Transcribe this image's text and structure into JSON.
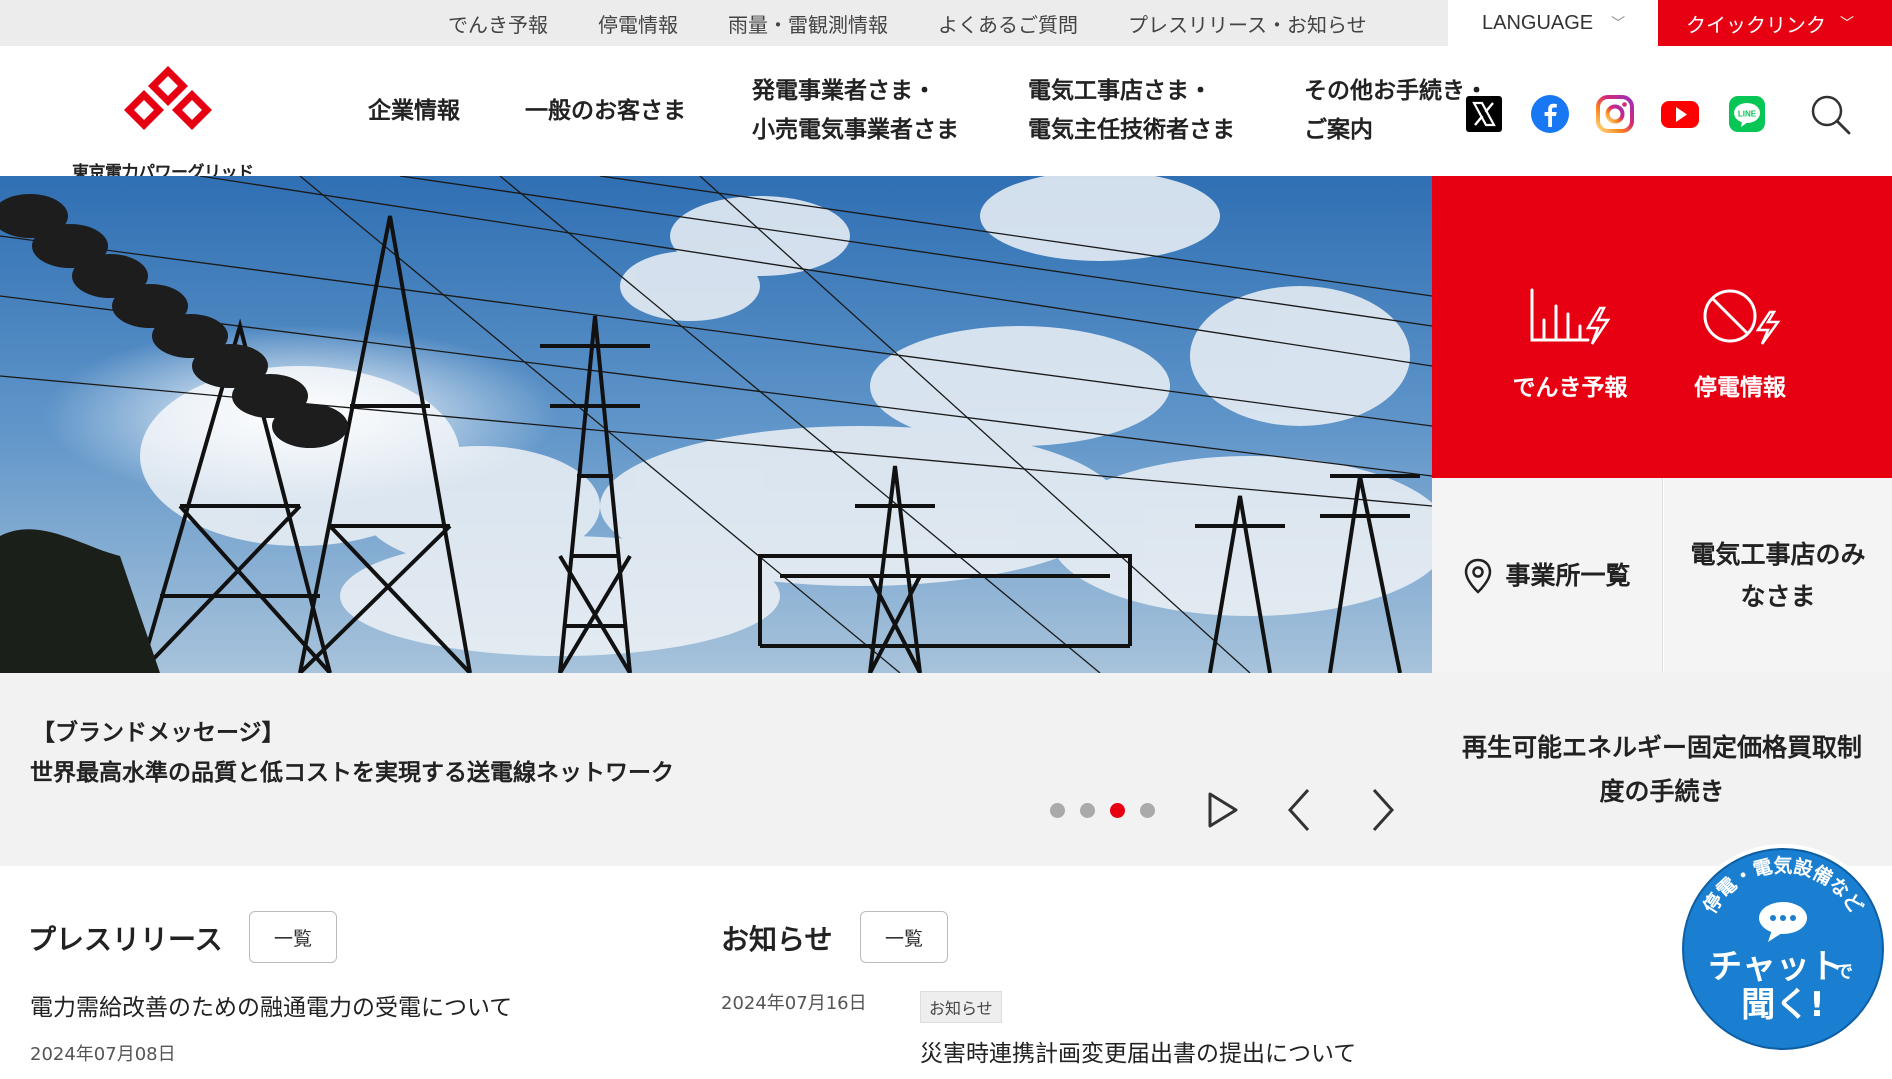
{
  "utility_nav": {
    "links": [
      "でんき予報",
      "停電情報",
      "雨量・雷観測情報",
      "よくあるご質問",
      "プレスリリース・お知らせ"
    ],
    "language": "LANGUAGE",
    "quick_link": "クイックリンク"
  },
  "header": {
    "logo_text": "東京電力パワーグリッド",
    "nav": [
      {
        "line1": "企業情報",
        "line2": ""
      },
      {
        "line1": "一般のお客さま",
        "line2": ""
      },
      {
        "line1": "発電事業者さま・",
        "line2": "小売電気事業者さま"
      },
      {
        "line1": "電気工事店さま・",
        "line2": "電気主任技術者さま"
      },
      {
        "line1": "その他お手続き・",
        "line2": "ご案内"
      }
    ],
    "social_icons": [
      "x-icon",
      "facebook-icon",
      "instagram-icon",
      "youtube-icon",
      "line-icon"
    ]
  },
  "side_panel": {
    "forecast_label": "でんき予報",
    "outage_label": "停電情報",
    "offices_label": "事業所一覧",
    "contractors_line1": "電気工事店のみ",
    "contractors_line2": "なさま",
    "fit_line1": "再生可能エネルギー固定価格買取制",
    "fit_line2": "度の手続き"
  },
  "hero": {
    "tag": "【ブランドメッセージ】",
    "message": "世界最高水準の品質と低コストを実現する送電線ネットワーク",
    "slide_count": 4,
    "active_slide": 3
  },
  "press": {
    "title": "プレスリリース",
    "list_button": "一覧",
    "items": [
      {
        "title": "電力需給改善のための融通電力の受電について",
        "date": "2024年07月08日"
      }
    ]
  },
  "notices": {
    "title": "お知らせ",
    "list_button": "一覧",
    "items": [
      {
        "date": "2024年07月16日",
        "category": "お知らせ",
        "title": "災害時連携計画変更届出書の提出について"
      }
    ]
  },
  "chat": {
    "arc_text": "停電・電気設備など",
    "line1": "チャット",
    "line1_suffix": "で",
    "line2": "聞く!"
  },
  "colors": {
    "brand_red": "#e60012",
    "chat_blue": "#1a7fd0"
  }
}
